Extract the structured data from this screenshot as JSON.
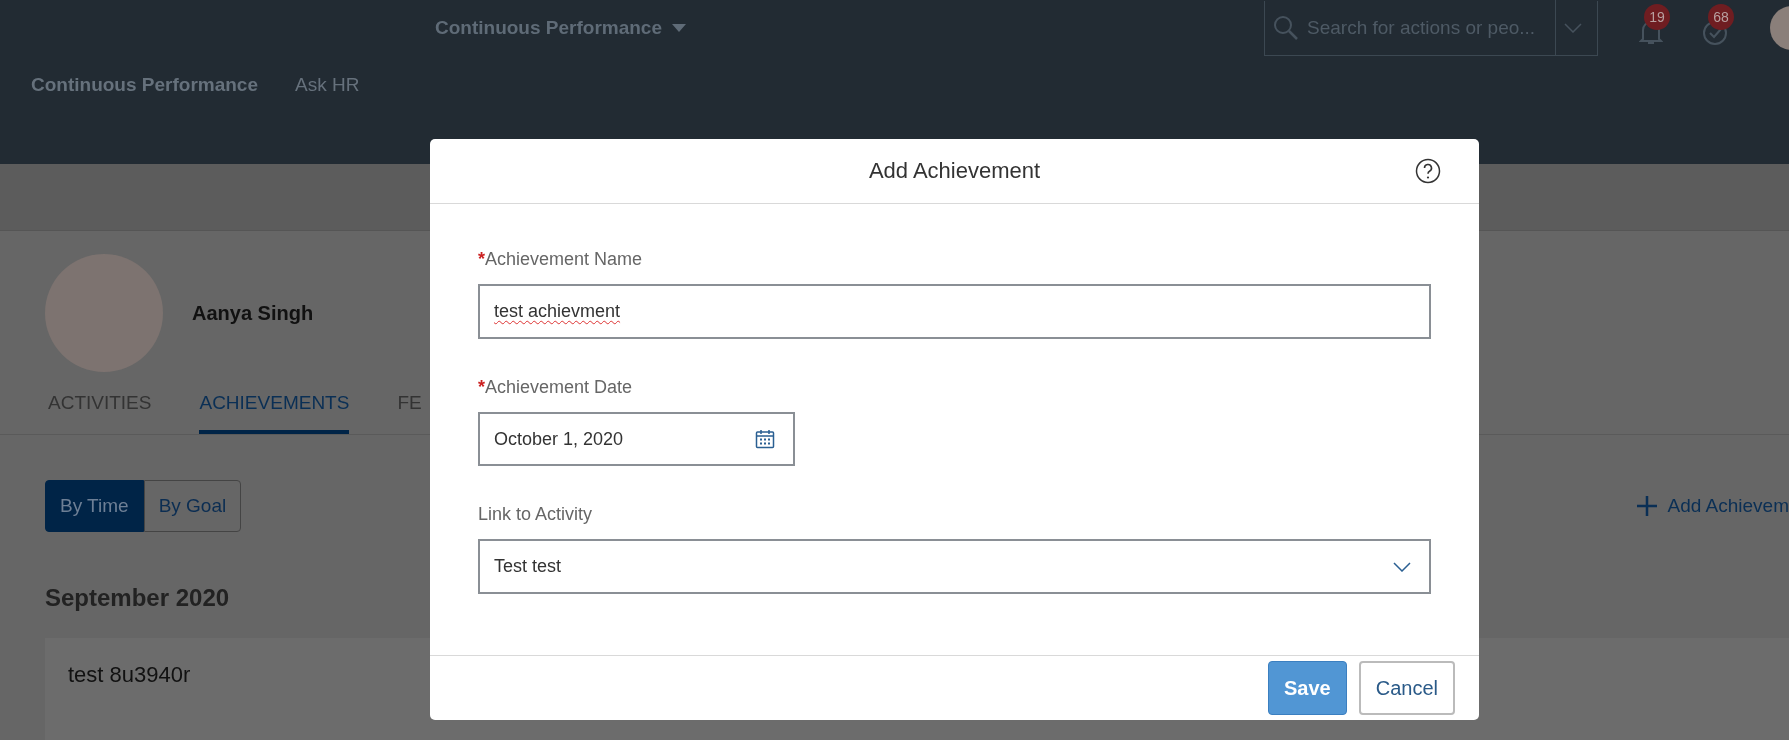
{
  "header": {
    "title": "Continuous Performance",
    "search": {
      "placeholder": "Search for actions or peo..."
    },
    "notifications": [
      {
        "kind": "bell",
        "count": "19"
      },
      {
        "kind": "check",
        "count": "68"
      }
    ]
  },
  "nav": [
    {
      "label": "Continuous Performance",
      "selected": true
    },
    {
      "label": "Ask HR",
      "selected": false
    }
  ],
  "profile": {
    "name": "Aanya Singh"
  },
  "tabs": [
    {
      "label": "ACTIVITIES",
      "selected": false
    },
    {
      "label": "ACHIEVEMENTS",
      "selected": true
    },
    {
      "label": "FE",
      "selected": false
    }
  ],
  "view_toggle": [
    {
      "label": "By Time",
      "selected": true
    },
    {
      "label": "By Goal",
      "selected": false
    }
  ],
  "add_button": "Add Achievem",
  "sections": [
    {
      "heading": "September 2020",
      "items": [
        "test 8u3940r"
      ]
    }
  ],
  "dialog": {
    "title": "Add Achievement",
    "fields": [
      {
        "kind": "text",
        "label": "Achievement Name",
        "required_mark": "*",
        "value": "test achievment"
      },
      {
        "kind": "date",
        "label": "Achievement Date",
        "required_mark": "*",
        "value": "October 1, 2020"
      },
      {
        "kind": "select",
        "label": "Link to Activity",
        "value": "Test test"
      }
    ],
    "buttons": [
      {
        "label": "Save",
        "kind": "primary"
      },
      {
        "label": "Cancel",
        "kind": "secondary"
      }
    ]
  }
}
